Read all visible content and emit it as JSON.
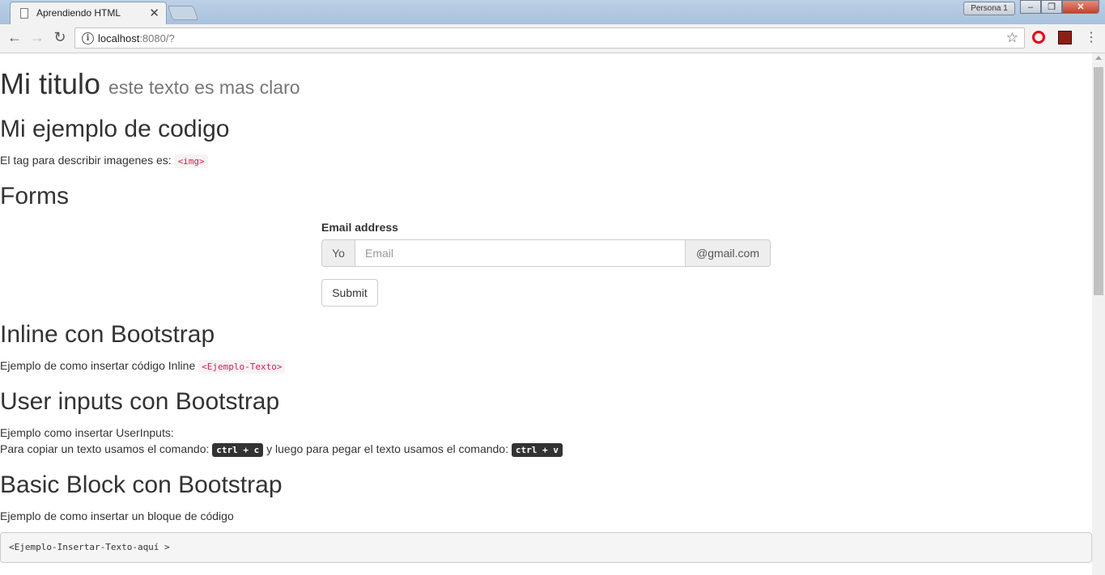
{
  "browser": {
    "tab_title": "Aprendiendo HTML",
    "tab_close": "✕",
    "profile": "Persona 1",
    "window_buttons": {
      "minimize": "‒",
      "maximize": "❐",
      "close": "✕"
    },
    "nav": {
      "back": "←",
      "forward": "→",
      "reload": "↻"
    },
    "url_host": "localhost",
    "url_rest": ":8080/?",
    "star": "☆",
    "menu": "⋮"
  },
  "page": {
    "title": "Mi titulo",
    "title_small": "este texto es mas claro",
    "section_codigo": {
      "heading": "Mi ejemplo de codigo",
      "text": "El tag para describir imagenes es: ",
      "code": "<img>"
    },
    "section_forms": {
      "heading": "Forms",
      "email_label": "Email address",
      "addon_left": "Yo",
      "email_placeholder": "Email",
      "email_value": "",
      "addon_right": "@gmail.com",
      "submit_label": "Submit"
    },
    "section_inline": {
      "heading": "Inline con Bootstrap",
      "text": "Ejemplo de como insertar código Inline ",
      "code": "<Ejemplo-Texto>"
    },
    "section_user_inputs": {
      "heading": "User inputs con Bootstrap",
      "line1": "Ejemplo como insertar UserInputs:",
      "line2_part1": "Para copiar un texto usamos el comando: ",
      "kbd_copy": "ctrl + c",
      "line2_part2": " y luego para pegar el texto usamos el comando: ",
      "kbd_paste": "ctrl + v"
    },
    "section_block": {
      "heading": "Basic Block con Bootstrap",
      "text": "Ejemplo de como insertar un bloque de código",
      "pre": "<Ejemplo-Insertar-Texto-aquí >"
    }
  }
}
